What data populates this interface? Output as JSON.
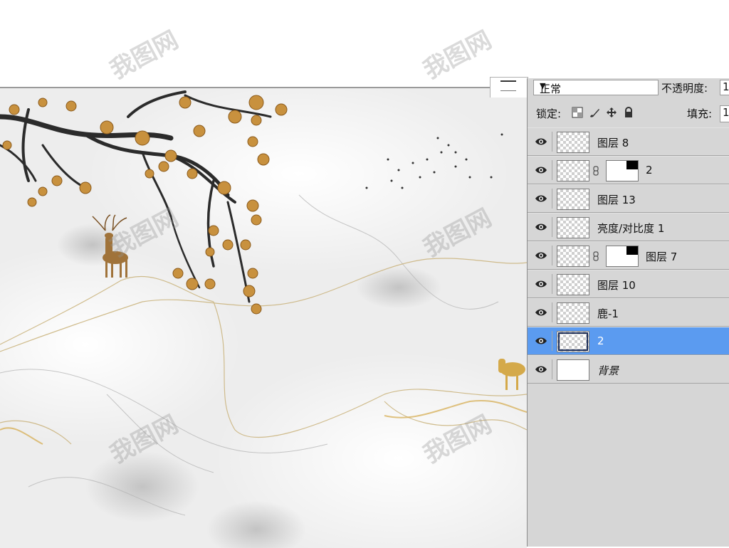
{
  "watermark": "我图网",
  "panel": {
    "blend_mode": "正常",
    "opacity_label": "不透明度:",
    "opacity_value": "1",
    "lock_label": "锁定:",
    "fill_label": "填充:",
    "fill_value": "1"
  },
  "layers": [
    {
      "name": "图层 8",
      "visible": true,
      "thumb": "transparent",
      "mask": false,
      "selected": false
    },
    {
      "name": "2",
      "visible": true,
      "thumb": "transparent",
      "mask": true,
      "selected": false
    },
    {
      "name": "图层 13",
      "visible": true,
      "thumb": "transparent",
      "mask": false,
      "selected": false
    },
    {
      "name": "亮度/对比度 1",
      "visible": true,
      "thumb": "transparent",
      "mask": false,
      "selected": false
    },
    {
      "name": "图层 7",
      "visible": true,
      "thumb": "transparent",
      "mask": true,
      "selected": false
    },
    {
      "name": "图层 10",
      "visible": true,
      "thumb": "transparent",
      "mask": false,
      "selected": false
    },
    {
      "name": "鹿-1",
      "visible": true,
      "thumb": "transparent",
      "mask": false,
      "selected": false
    },
    {
      "name": "2",
      "visible": true,
      "thumb": "transparent",
      "mask": false,
      "selected": true
    },
    {
      "name": "背景",
      "visible": true,
      "thumb": "white",
      "mask": false,
      "selected": false
    }
  ],
  "colors": {
    "selection": "#5b9bf0",
    "panel": "#d6d6d6",
    "blossom": "#c8913e",
    "gold": "#d4a94a"
  }
}
